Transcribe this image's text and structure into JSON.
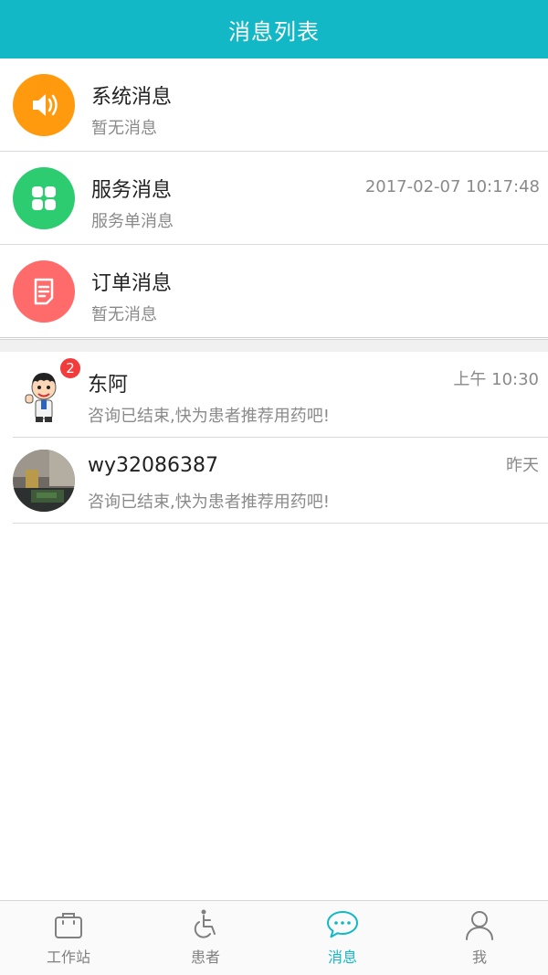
{
  "header": {
    "title": "消息列表"
  },
  "system_messages": [
    {
      "title": "系统消息",
      "subtitle": "暂无消息",
      "time": "",
      "icon": "speaker-icon",
      "color": "#ff9a0f"
    },
    {
      "title": "服务消息",
      "subtitle": "服务单消息",
      "time": "2017-02-07 10:17:48",
      "icon": "grid-icon",
      "color": "#2ecc71"
    },
    {
      "title": "订单消息",
      "subtitle": "暂无消息",
      "time": "",
      "icon": "document-icon",
      "color": "#ff6b6b"
    }
  ],
  "chats": [
    {
      "name": "东阿",
      "message": "咨询已结束,快为患者推荐用药吧!",
      "time": "上午 10:30",
      "badge": "2"
    },
    {
      "name": "wy32086387",
      "message": "咨询已结束,快为患者推荐用药吧!",
      "time": "昨天"
    }
  ],
  "tabs": [
    {
      "label": "工作站",
      "icon": "briefcase-icon"
    },
    {
      "label": "患者",
      "icon": "wheelchair-icon"
    },
    {
      "label": "消息",
      "icon": "chat-bubble-icon",
      "active": true
    },
    {
      "label": "我",
      "icon": "person-icon"
    }
  ],
  "colors": {
    "accent": "#13b8c6",
    "badge": "#f23b3b"
  }
}
